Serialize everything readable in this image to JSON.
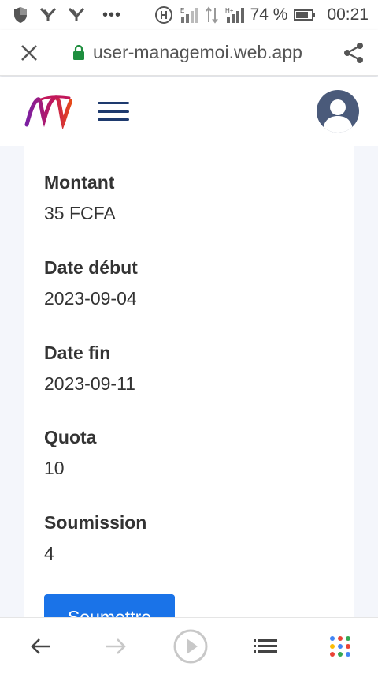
{
  "status_bar": {
    "battery": "74 %",
    "time": "00:21"
  },
  "browser": {
    "url": "user-managemoi.web.app"
  },
  "details": {
    "fields": [
      {
        "label": "Montant",
        "value": "35 FCFA"
      },
      {
        "label": "Date début",
        "value": "2023-09-04"
      },
      {
        "label": "Date fin",
        "value": "2023-09-11"
      },
      {
        "label": "Quota",
        "value": "10"
      },
      {
        "label": "Soumission",
        "value": "4"
      }
    ],
    "submit_label": "Soumettre"
  },
  "colors": {
    "primary": "#1a73e8",
    "nav_dark": "#1e3a6e",
    "lock_green": "#1e8e3e"
  }
}
